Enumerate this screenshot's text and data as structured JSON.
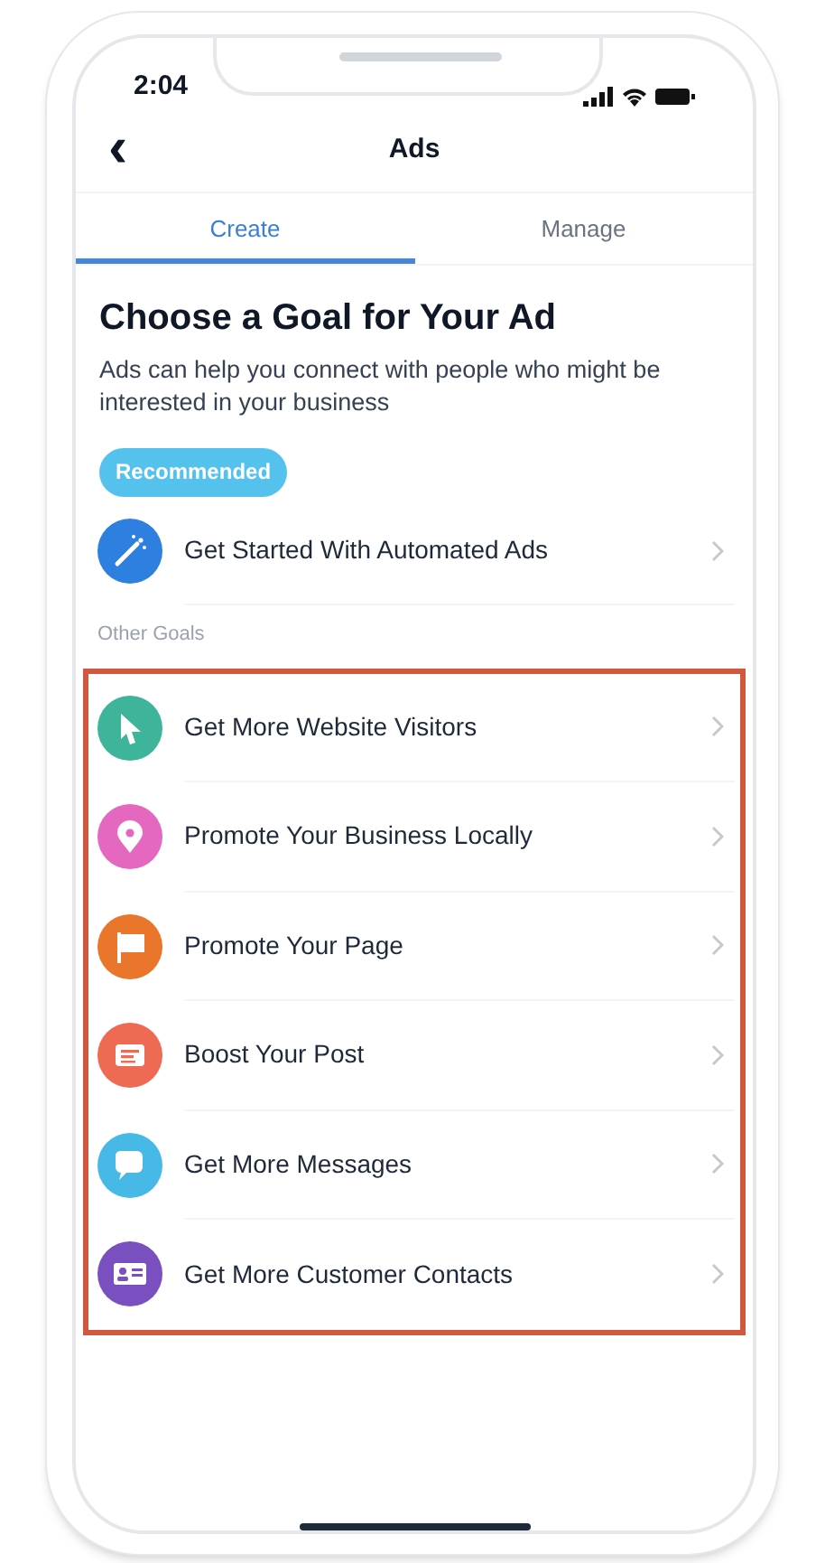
{
  "status_bar": {
    "time": "2:04"
  },
  "nav": {
    "back": "‹",
    "title": "Ads"
  },
  "tabs": [
    {
      "label": "Create",
      "selected": true
    },
    {
      "label": "Manage",
      "selected": false
    }
  ],
  "heading": "Choose a Goal for Your Ad",
  "description": "Ads can help you connect with people who might be interested in your business",
  "recommended": {
    "badge": "Recommended",
    "items": [
      {
        "label": "Get Started With Automated Ads",
        "kind": "wand",
        "color": "#2d7fe0"
      }
    ]
  },
  "other_goals": {
    "label": "Other Goals",
    "highlighted": true,
    "items": [
      {
        "label": "Get More Website Visitors",
        "kind": "cursor",
        "color": "#3eb49a"
      },
      {
        "label": "Promote Your Business Locally",
        "kind": "pin",
        "color": "#e468c0"
      },
      {
        "label": "Promote Your Page",
        "kind": "flag",
        "color": "#e9762b"
      },
      {
        "label": "Boost Your Post",
        "kind": "post",
        "color": "#ee6a52"
      },
      {
        "label": "Get More Messages",
        "kind": "chat",
        "color": "#47b9e6"
      },
      {
        "label": "Get More Customer Contacts",
        "kind": "card",
        "color": "#7a4fc0"
      }
    ]
  }
}
